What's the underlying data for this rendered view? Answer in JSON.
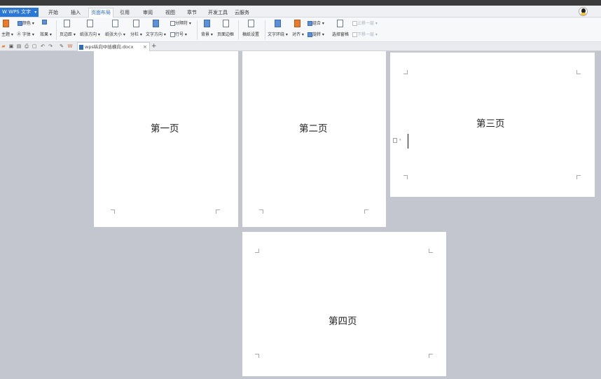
{
  "app": {
    "name": "WPS 文字"
  },
  "menu": {
    "tabs": [
      {
        "label": "开始"
      },
      {
        "label": "插入"
      },
      {
        "label": "页面布局"
      },
      {
        "label": "引用"
      },
      {
        "label": "审阅"
      },
      {
        "label": "视图"
      },
      {
        "label": "章节"
      },
      {
        "label": "开发工具"
      },
      {
        "label": "云服务"
      }
    ],
    "active_tab": "页面布局"
  },
  "ribbon": {
    "theme": "主题",
    "colors": "颜色",
    "fonts": "字体",
    "effects": "效果",
    "margins": "页边距",
    "orientation": "纸张方向",
    "size": "纸张大小",
    "columns": "分栏",
    "text_direction": "文字方向",
    "breaks": "分隔符",
    "line_numbers": "行号",
    "background": "背景",
    "page_border": "页面边框",
    "manuscript": "稿纸设置",
    "wrap_text": "文字环绕",
    "align": "对齐",
    "group": "组合",
    "rotate": "旋转",
    "selection_pane": "选择窗格",
    "bring_forward": "上移一层",
    "send_backward": "下移一层"
  },
  "doc_tab": {
    "filename": "wps纵向中插横向.docx"
  },
  "pages": {
    "p1": "第一页",
    "p2": "第二页",
    "p3": "第三页",
    "p4": "第四页"
  },
  "colors": {
    "accent": "#2b78d4",
    "canvas": "#c3c6cf"
  }
}
